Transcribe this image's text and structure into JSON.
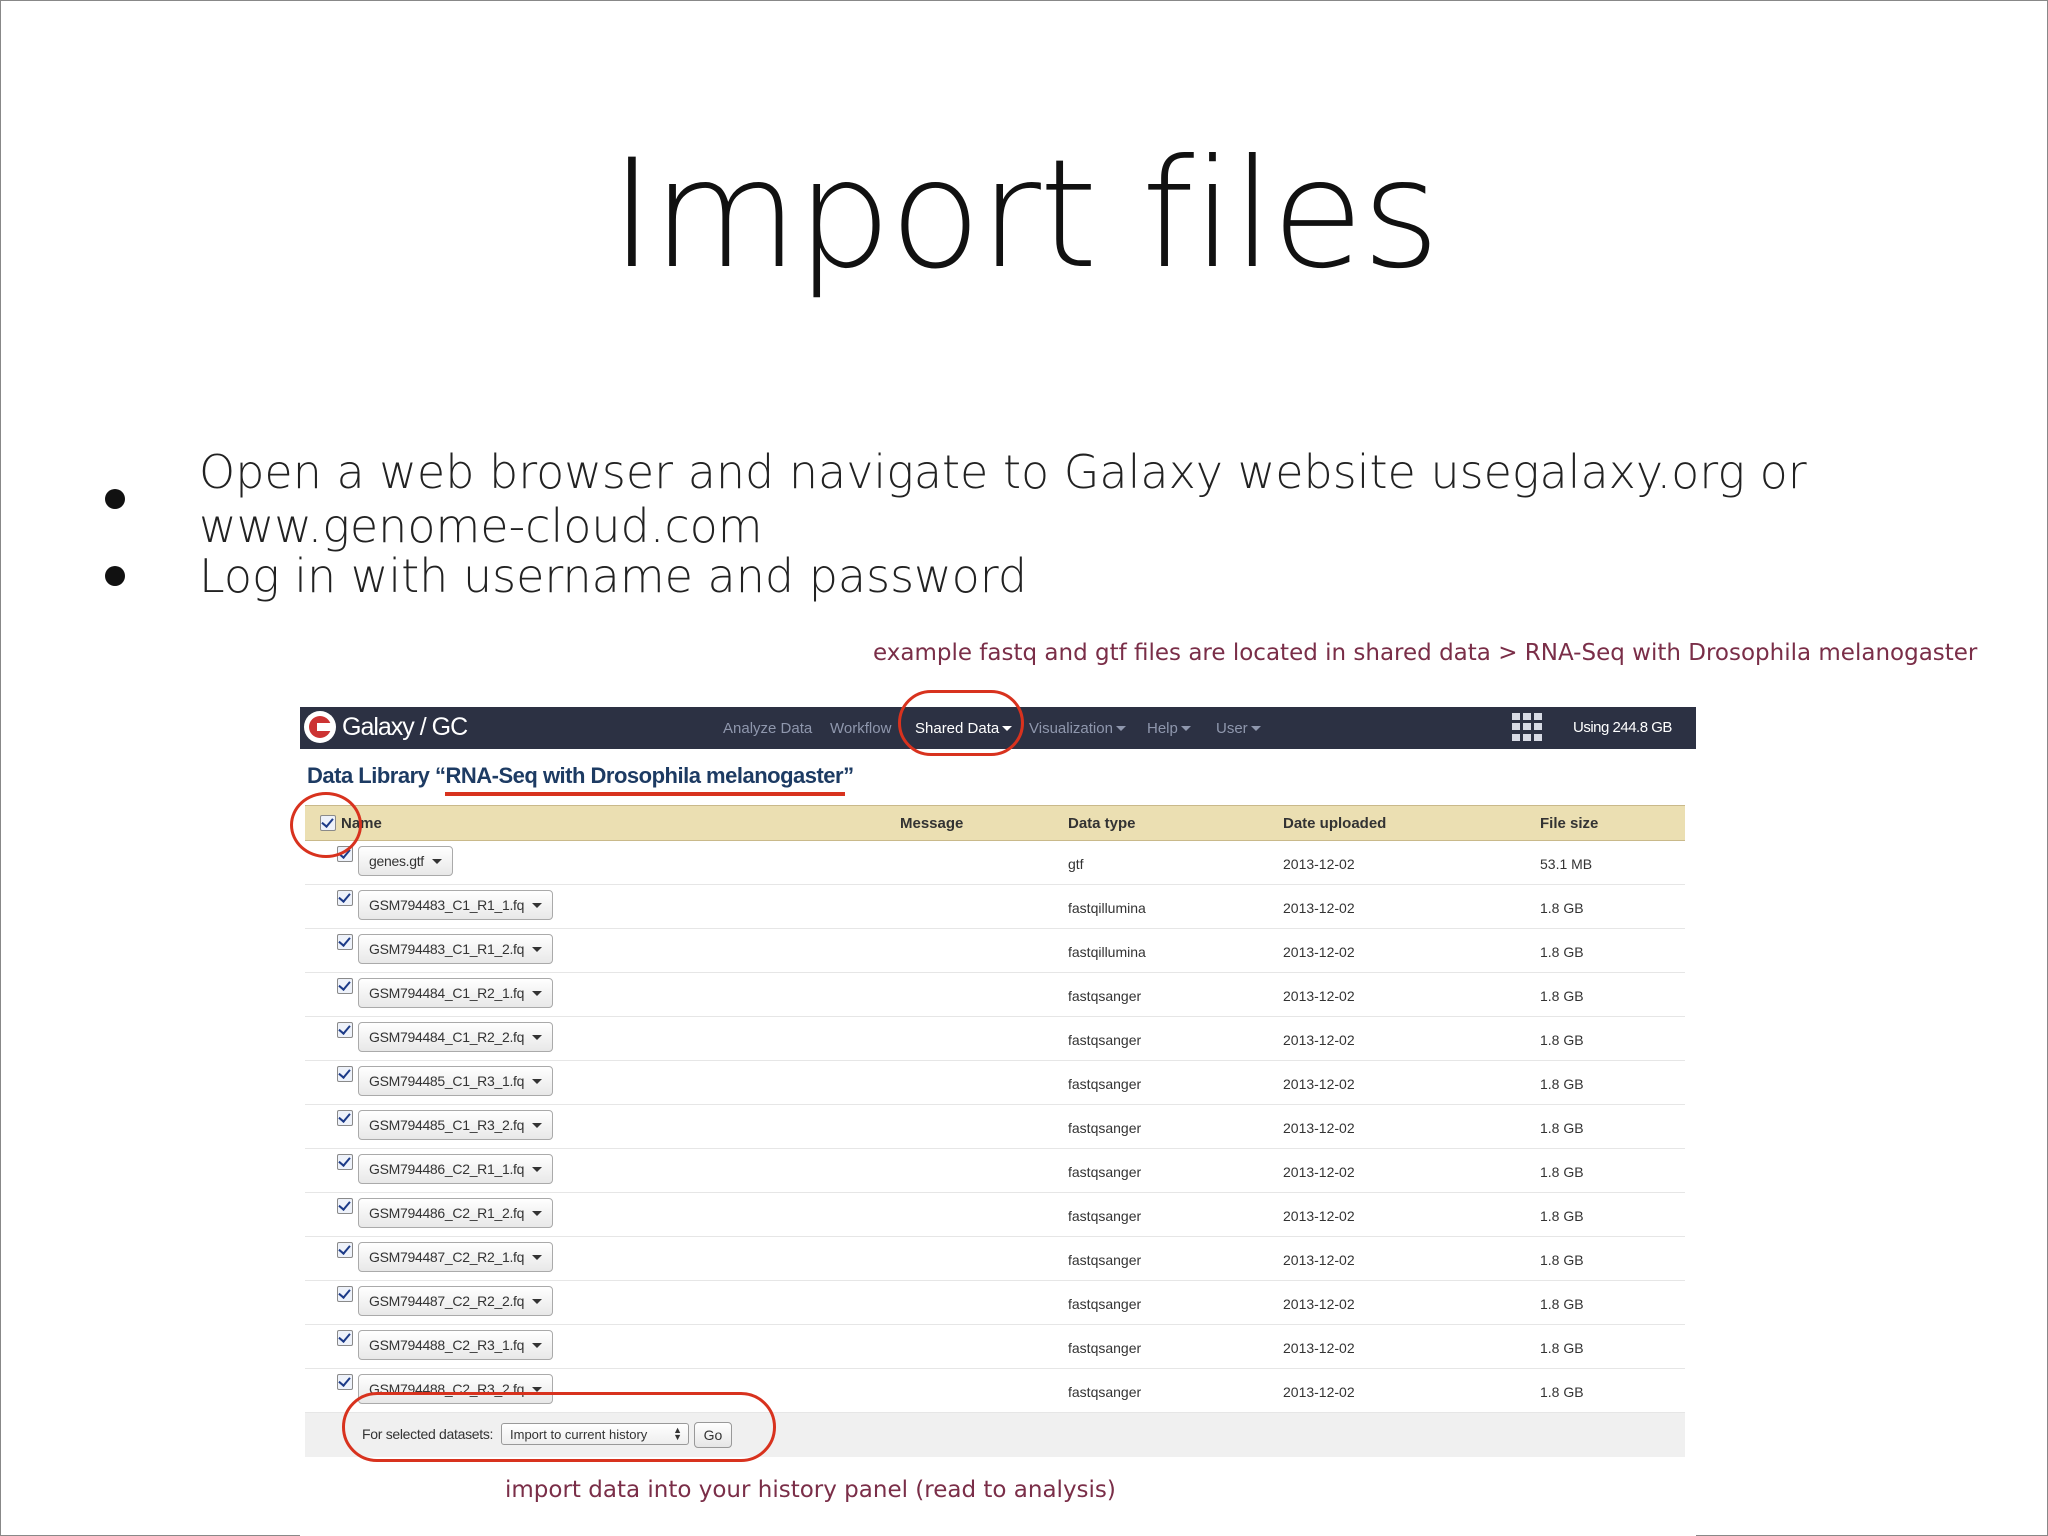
{
  "slide": {
    "title": "Import files",
    "bullets": [
      "Open a web browser and navigate to Galaxy website usegalaxy.org or www.genome-cloud.com",
      "Log in with username and password"
    ],
    "annotation_top": "example fastq and gtf files are located in shared data > RNA-Seq with Drosophila melanogaster",
    "annotation_bottom": "import data into your history panel (read to analysis)",
    "highlight_color": "#d8321e",
    "annotation_color": "#7a2e48"
  },
  "galaxy": {
    "brand": "Galaxy / GC",
    "nav": {
      "analyze": "Analyze Data",
      "workflow": "Workflow",
      "shared": "Shared Data",
      "visualization": "Visualization",
      "help": "Help",
      "user": "User"
    },
    "quota": "Using 244.8 GB",
    "library_title": "Data Library “RNA-Seq with Drosophila melanogaster”",
    "columns": {
      "name": "Name",
      "message": "Message",
      "datatype": "Data type",
      "date": "Date uploaded",
      "size": "File size"
    },
    "rows": [
      {
        "name": "genes.gtf",
        "type": "gtf",
        "date": "2013-12-02",
        "size": "53.1 MB"
      },
      {
        "name": "GSM794483_C1_R1_1.fq",
        "type": "fastqillumina",
        "date": "2013-12-02",
        "size": "1.8 GB"
      },
      {
        "name": "GSM794483_C1_R1_2.fq",
        "type": "fastqillumina",
        "date": "2013-12-02",
        "size": "1.8 GB"
      },
      {
        "name": "GSM794484_C1_R2_1.fq",
        "type": "fastqsanger",
        "date": "2013-12-02",
        "size": "1.8 GB"
      },
      {
        "name": "GSM794484_C1_R2_2.fq",
        "type": "fastqsanger",
        "date": "2013-12-02",
        "size": "1.8 GB"
      },
      {
        "name": "GSM794485_C1_R3_1.fq",
        "type": "fastqsanger",
        "date": "2013-12-02",
        "size": "1.8 GB"
      },
      {
        "name": "GSM794485_C1_R3_2.fq",
        "type": "fastqsanger",
        "date": "2013-12-02",
        "size": "1.8 GB"
      },
      {
        "name": "GSM794486_C2_R1_1.fq",
        "type": "fastqsanger",
        "date": "2013-12-02",
        "size": "1.8 GB"
      },
      {
        "name": "GSM794486_C2_R1_2.fq",
        "type": "fastqsanger",
        "date": "2013-12-02",
        "size": "1.8 GB"
      },
      {
        "name": "GSM794487_C2_R2_1.fq",
        "type": "fastqsanger",
        "date": "2013-12-02",
        "size": "1.8 GB"
      },
      {
        "name": "GSM794487_C2_R2_2.fq",
        "type": "fastqsanger",
        "date": "2013-12-02",
        "size": "1.8 GB"
      },
      {
        "name": "GSM794488_C2_R3_1.fq",
        "type": "fastqsanger",
        "date": "2013-12-02",
        "size": "1.8 GB"
      },
      {
        "name": "GSM794488_C2_R3_2.fq",
        "type": "fastqsanger",
        "date": "2013-12-02",
        "size": "1.8 GB"
      }
    ],
    "footer": {
      "label": "For selected datasets:",
      "select_value": "Import to current history",
      "go_label": "Go"
    }
  }
}
